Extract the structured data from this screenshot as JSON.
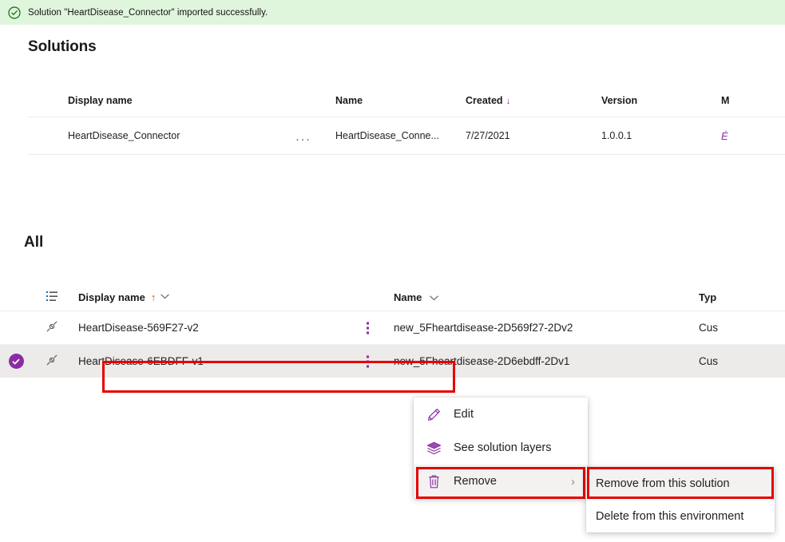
{
  "banner": {
    "icon": "check-circle-icon",
    "message": "Solution \"HeartDisease_Connector\" imported successfully.",
    "background": "#dff6dd",
    "icon_color": "#107c10"
  },
  "solutions_section": {
    "title": "Solutions",
    "columns": [
      {
        "label": "Display name"
      },
      {
        "label": "Name"
      },
      {
        "label": "Created",
        "sort": "↓"
      },
      {
        "label": "Version"
      },
      {
        "label": "M"
      }
    ],
    "rows": [
      {
        "overflow": "···",
        "display_name": "HeartDisease_Connector",
        "name": "HeartDisease_Conne...",
        "created": "7/27/2021",
        "version": "1.0.0.1",
        "managed": "É"
      }
    ]
  },
  "all_section": {
    "title": "All",
    "columns": [
      {
        "label": "",
        "icon": "list-columns-icon"
      },
      {
        "label": "Display name",
        "sort_arrow": "↑",
        "chevron": "⌄"
      },
      {
        "label": "Name",
        "chevron": "⌄"
      },
      {
        "label": "Typ"
      }
    ],
    "rows": [
      {
        "selected": false,
        "icon": "connector-plug-icon",
        "display_name": "HeartDisease-569F27-v2",
        "name": "new_5Fheartdisease-2D569f27-2Dv2",
        "type": "Cus"
      },
      {
        "selected": true,
        "icon": "connector-plug-icon",
        "display_name": "HeartDisease-6EBDFF-v1",
        "name": "new_5Fheartdisease-2D6ebdff-2Dv1",
        "type": "Cus"
      }
    ]
  },
  "context_menu": {
    "items": [
      {
        "label": "Edit",
        "icon": "pencil-icon",
        "hover": false,
        "submenu_arrow": ""
      },
      {
        "label": "See solution layers",
        "icon": "layers-icon",
        "hover": false,
        "submenu_arrow": ""
      },
      {
        "label": "Remove",
        "icon": "trash-icon",
        "hover": true,
        "submenu_arrow": "›"
      }
    ]
  },
  "submenu": {
    "items": [
      {
        "label": "Remove from this solution",
        "hover": true
      },
      {
        "label": "Delete from this environment",
        "hover": false
      }
    ]
  },
  "colors": {
    "accent_purple": "#8a2da5",
    "highlight_red": "#e60000",
    "selected_row": "#edebe9",
    "success_green": "#dff6dd"
  }
}
